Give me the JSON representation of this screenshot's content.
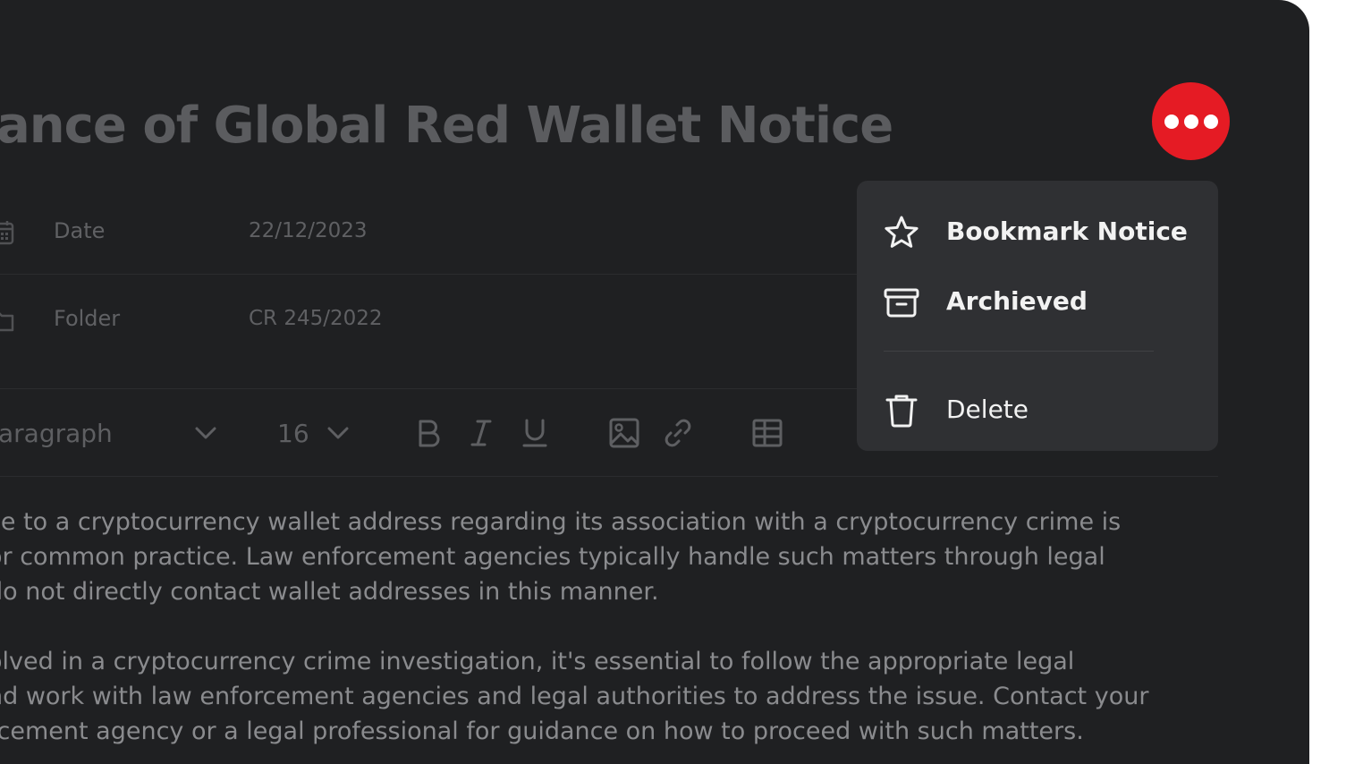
{
  "notice": {
    "title": "ance of Global Red Wallet Notice",
    "fields": [
      {
        "label": "Date",
        "value": "22/12/2023"
      },
      {
        "label": "Folder",
        "value": "CR 245/2022"
      }
    ]
  },
  "toolbar": {
    "paragraph_style": "aragraph",
    "font_size": "16"
  },
  "body": {
    "paragraph1": [
      "ce to a cryptocurrency wallet address regarding its association with a cryptocurrency crime is",
      "or common practice. Law enforcement agencies typically handle such matters through legal",
      " do not directly contact wallet addresses in this manner."
    ],
    "paragraph2": [
      "olved in a cryptocurrency crime investigation, it's essential to follow the appropriate legal",
      "nd work with law enforcement agencies and legal authorities to address the issue. Contact your",
      "rcement agency or a legal professional for guidance on how to proceed with such matters."
    ]
  },
  "menu": {
    "items": [
      {
        "label": "Bookmark Notice",
        "icon": "star-icon"
      },
      {
        "label": "Archieved",
        "icon": "archive-icon"
      },
      {
        "label": "Delete",
        "icon": "trash-icon"
      }
    ]
  },
  "colors": {
    "accent": "#e51b24",
    "background": "#1f2022",
    "menu_background": "#2f3033"
  }
}
